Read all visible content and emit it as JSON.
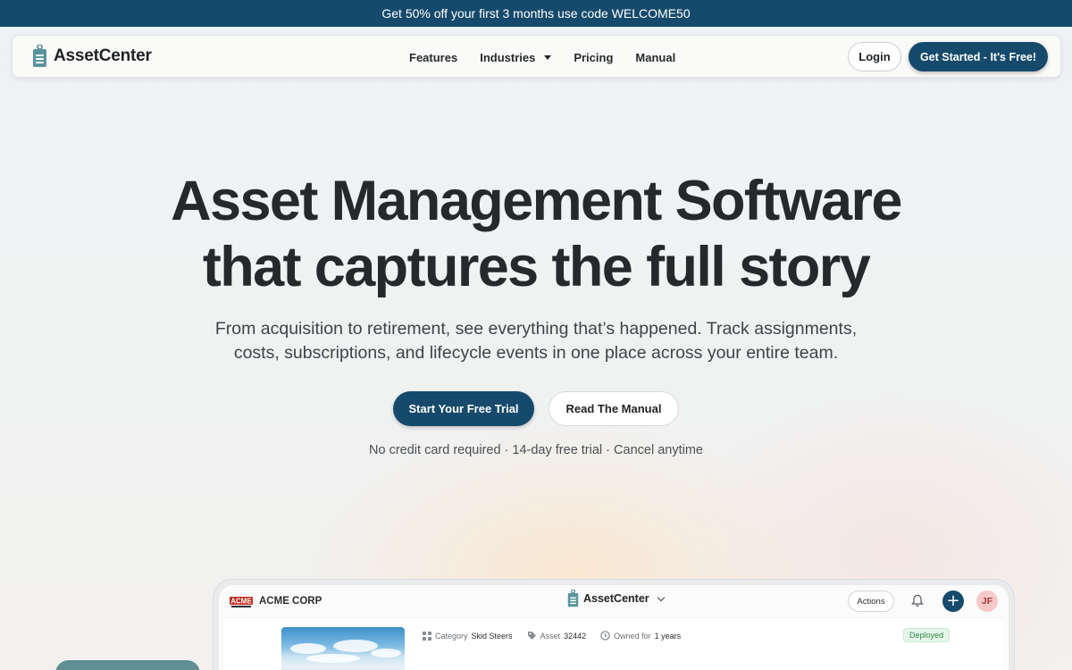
{
  "promo": {
    "text": "Get 50% off your first 3 months use code WELCOME50"
  },
  "nav": {
    "brand": "AssetCenter",
    "links": [
      {
        "label": "Features"
      },
      {
        "label": "Industries",
        "has_dropdown": true
      },
      {
        "label": "Pricing"
      },
      {
        "label": "Manual"
      }
    ],
    "login_label": "Login",
    "cta_label": "Get Started - It's Free!"
  },
  "hero": {
    "title_line1": "Asset Management Software",
    "title_line2": "that captures the full story",
    "subtitle_line1": "From acquisition to retirement, see everything that’s happened. Track assignments,",
    "subtitle_line2": "costs, subscriptions, and lifecycle events in one place across your entire team.",
    "primary_cta": "Start Your Free Trial",
    "secondary_cta": "Read The Manual",
    "note": "No credit card required · 14-day free trial · Cancel anytime"
  },
  "preview": {
    "company_logo_text": "ACME",
    "company": "ACME CORP",
    "app_name": "AssetCenter",
    "actions_label": "Actions",
    "plus_label": "+",
    "avatar_initials": "JF",
    "asset": {
      "category_label": "Category",
      "category_value": "Skid Steers",
      "asset_label": "Asset",
      "asset_value": "32442",
      "owned_label": "Owned for",
      "owned_value": "1 years",
      "status": "Deployed"
    }
  },
  "colors": {
    "brand_navy": "#164a6c",
    "status_green": "#2f8a4a",
    "avatar_pink": "#f8c8c8"
  }
}
